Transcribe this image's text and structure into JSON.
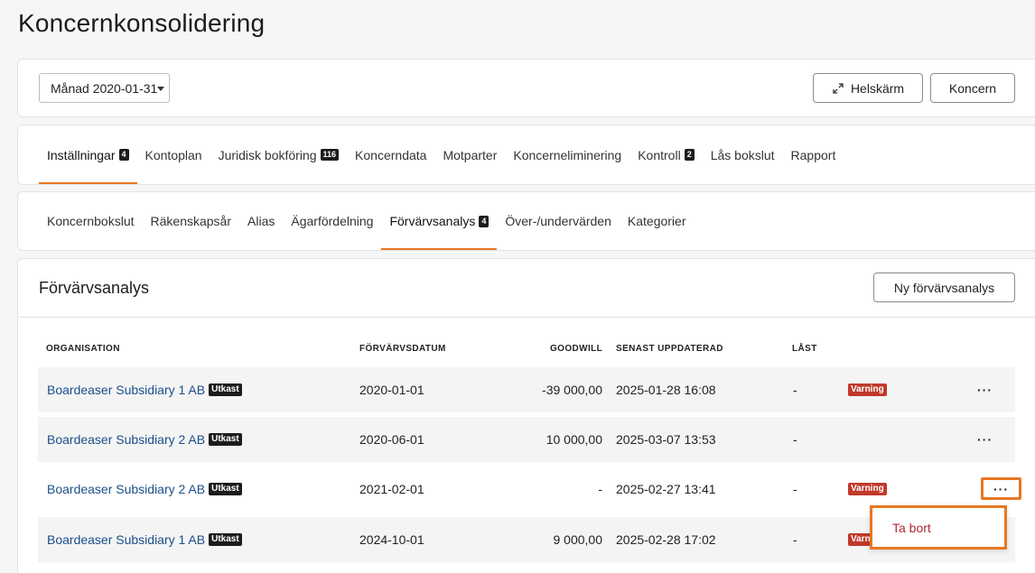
{
  "page": {
    "title": "Koncernkonsolidering"
  },
  "toolbar": {
    "period_select": "Månad 2020-01-31",
    "fullscreen_label": "Helskärm",
    "koncern_label": "Koncern"
  },
  "main_tabs": [
    {
      "label": "Inställningar",
      "badge": "4",
      "active": true
    },
    {
      "label": "Kontoplan"
    },
    {
      "label": "Juridisk bokföring",
      "badge": "116"
    },
    {
      "label": "Koncerndata"
    },
    {
      "label": "Motparter"
    },
    {
      "label": "Koncerneliminering"
    },
    {
      "label": "Kontroll",
      "badge": "2"
    },
    {
      "label": "Lås bokslut"
    },
    {
      "label": "Rapport"
    }
  ],
  "sub_tabs": [
    {
      "label": "Koncernbokslut"
    },
    {
      "label": "Räkenskapsår"
    },
    {
      "label": "Alias"
    },
    {
      "label": "Ägarfördelning"
    },
    {
      "label": "Förvärvsanalys",
      "badge": "4",
      "active": true
    },
    {
      "label": "Över-/undervärden"
    },
    {
      "label": "Kategorier"
    }
  ],
  "section": {
    "title": "Förvärvsanalys",
    "new_button": "Ny förvärvsanalys"
  },
  "table": {
    "headers": {
      "organisation": "ORGANISATION",
      "date": "FÖRVÄRVSDATUM",
      "goodwill": "GOODWILL",
      "updated": "SENAST UPPDATERAD",
      "locked": "LÅST"
    },
    "rows": [
      {
        "org": "Boardeaser Subsidiary 1 AB",
        "tag": "Utkast",
        "date": "2020-01-01",
        "goodwill": "-39 000,00",
        "updated": "2025-01-28 16:08",
        "locked": "-",
        "status": "Varning",
        "actions": "···"
      },
      {
        "org": "Boardeaser Subsidiary 2 AB",
        "tag": "Utkast",
        "date": "2020-06-01",
        "goodwill": "10 000,00",
        "updated": "2025-03-07 13:53",
        "locked": "-",
        "status": "",
        "actions": "···"
      },
      {
        "org": "Boardeaser Subsidiary 2 AB",
        "tag": "Utkast",
        "date": "2021-02-01",
        "goodwill": "-",
        "updated": "2025-02-27 13:41",
        "locked": "-",
        "status": "Varning",
        "actions": "···"
      },
      {
        "org": "Boardeaser Subsidiary 1 AB",
        "tag": "Utkast",
        "date": "2024-10-01",
        "goodwill": "9 000,00",
        "updated": "2025-02-28 17:02",
        "locked": "-",
        "status": "Varning",
        "actions": "···"
      }
    ]
  },
  "context_menu": {
    "delete_label": "Ta bort"
  },
  "colors": {
    "accent": "#e87722",
    "link": "#1b4f8a",
    "warning": "#c0392b",
    "danger_text": "#b3262f"
  }
}
